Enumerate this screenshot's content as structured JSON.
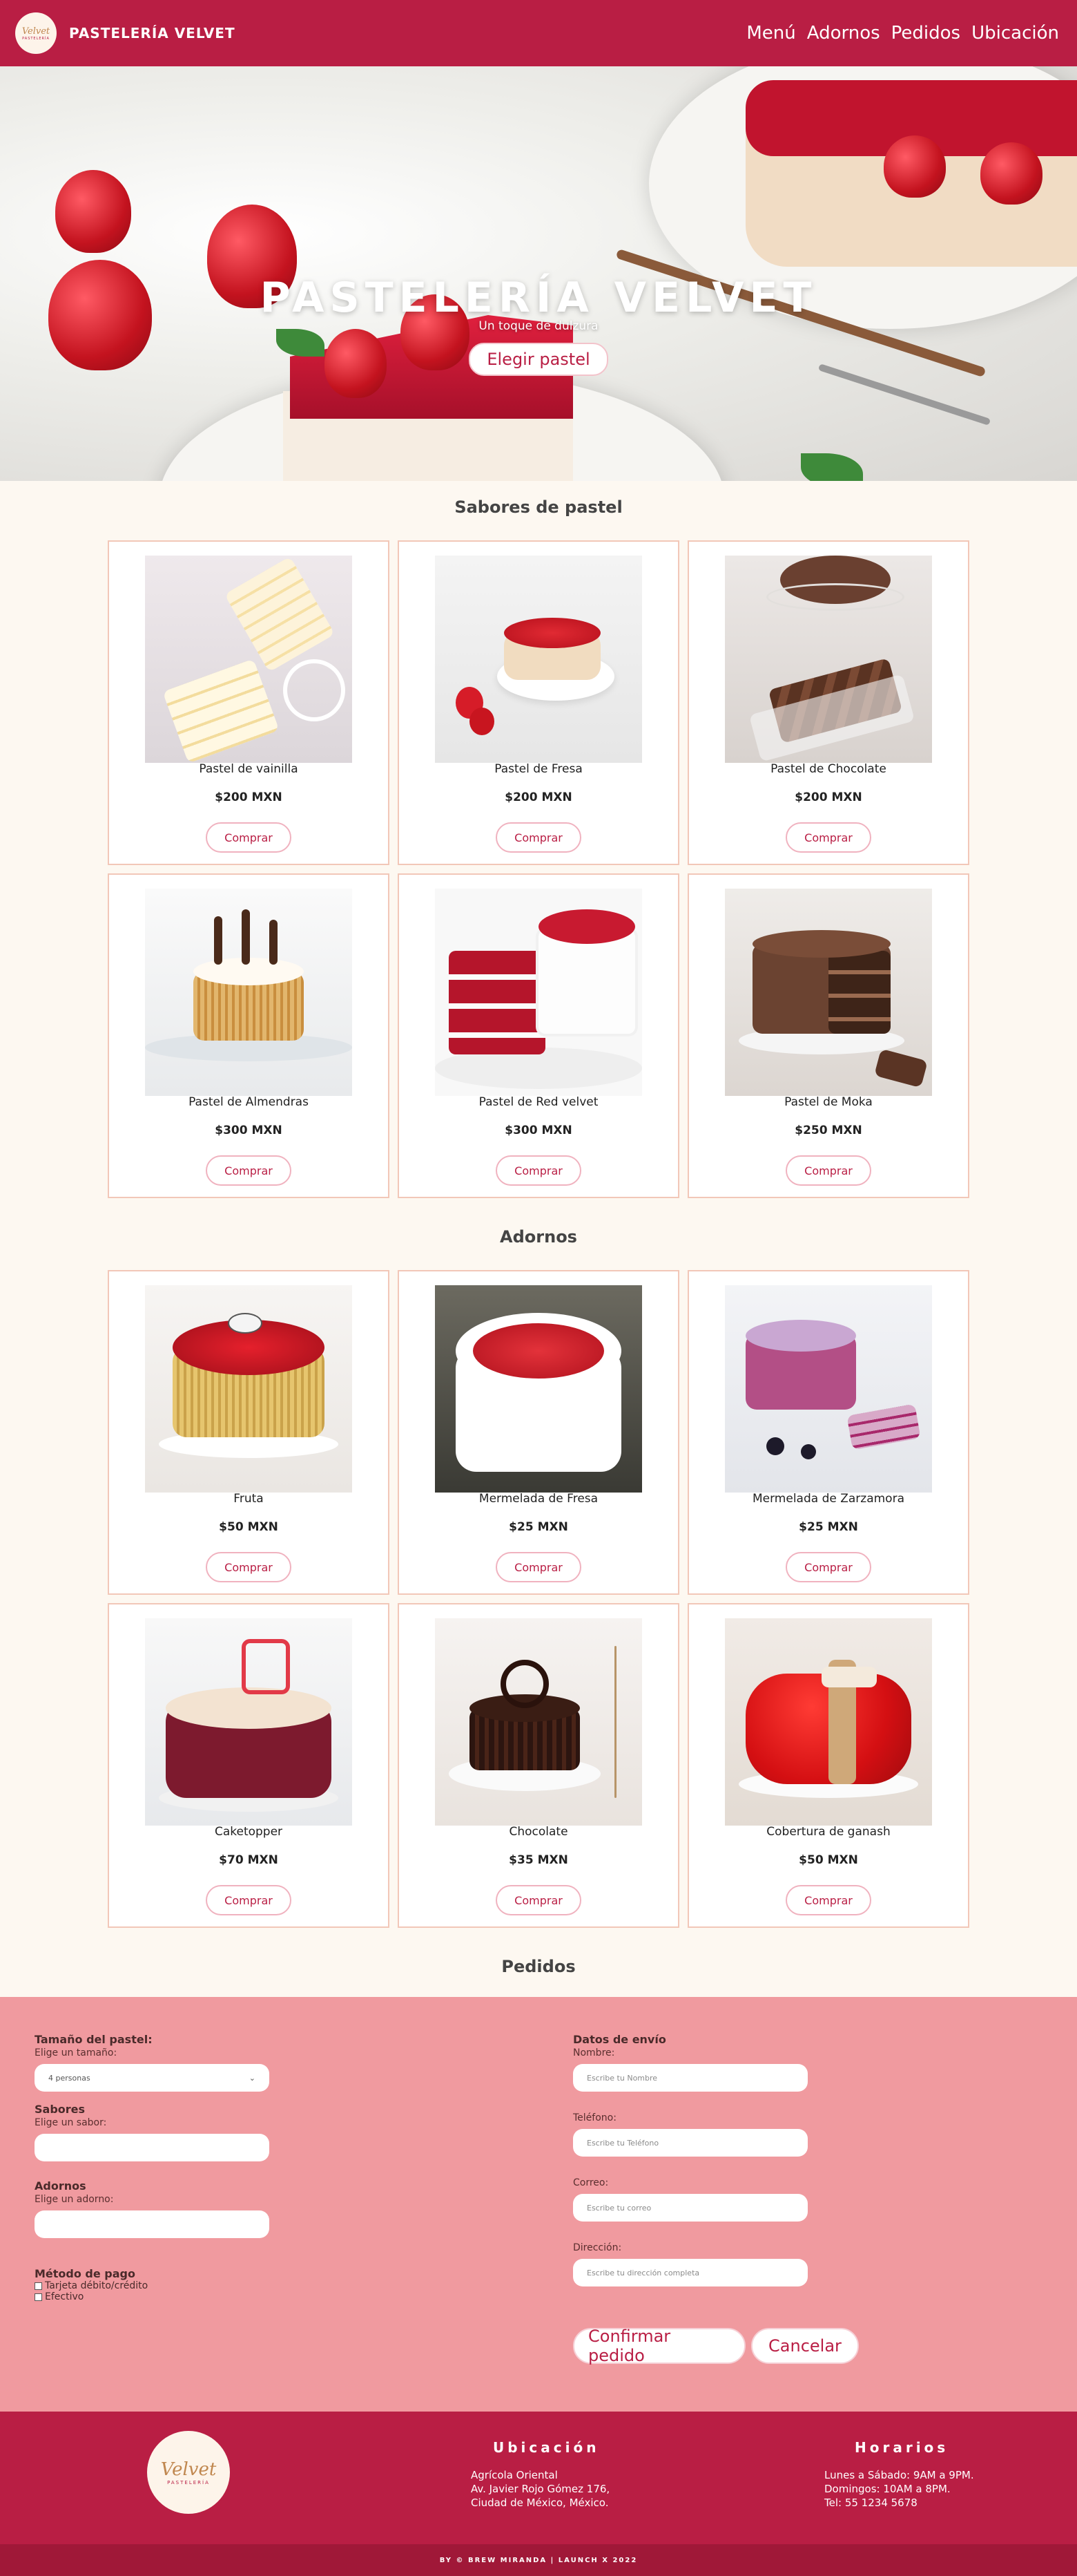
{
  "nav": {
    "logo_text": "Velvet",
    "logo_subtext": "PASTELERÍA",
    "brand": "PASTELERÍA VELVET",
    "links": [
      "Menú",
      "Adornos",
      "Pedidos",
      "Ubicación"
    ]
  },
  "hero": {
    "title": "PASTELERÍA VELVET",
    "subtitle": "Un toque de dulzura",
    "button": "Elegir pastel"
  },
  "flavors": {
    "title": "Sabores de pastel",
    "buy_label": "Comprar",
    "items": [
      {
        "name": "Pastel de vainilla",
        "price": "$200 MXN"
      },
      {
        "name": "Pastel de Fresa",
        "price": "$200 MXN"
      },
      {
        "name": "Pastel de Chocolate",
        "price": "$200 MXN"
      },
      {
        "name": "Pastel de Almendras",
        "price": "$300 MXN"
      },
      {
        "name": "Pastel de Red velvet",
        "price": "$300 MXN"
      },
      {
        "name": "Pastel de Moka",
        "price": "$250 MXN"
      }
    ]
  },
  "toppings": {
    "title": "Adornos",
    "buy_label": "Comprar",
    "items": [
      {
        "name": "Fruta",
        "price": "$50 MXN"
      },
      {
        "name": "Mermelada de Fresa",
        "price": "$25 MXN"
      },
      {
        "name": "Mermelada de Zarzamora",
        "price": "$25 MXN"
      },
      {
        "name": "Caketopper",
        "price": "$70 MXN"
      },
      {
        "name": "Chocolate",
        "price": "$35 MXN"
      },
      {
        "name": "Cobertura de ganash",
        "price": "$50 MXN"
      }
    ]
  },
  "orders": {
    "title": "Pedidos",
    "size_label": "Tamaño del pastel:",
    "size_sub": "Elige un tamaño:",
    "size_value": "4 personas",
    "flavor_label": "Sabores",
    "flavor_sub": "Elige un sabor:",
    "topping_label": "Adornos",
    "topping_sub": "Elige un adorno:",
    "payment_label": "Método de pago",
    "payment_options": [
      "Tarjeta débito/crédito",
      "Efectivo"
    ],
    "shipping_label": "Datos de envío",
    "name_label": "Nombre:",
    "name_placeholder": "Escribe tu Nombre",
    "phone_label": "Teléfono:",
    "phone_placeholder": "Escribe tu Teléfono",
    "email_label": "Correo:",
    "email_placeholder": "Escribe tu correo",
    "address_label": "Dirección:",
    "address_placeholder": "Escribe tu dirección completa",
    "confirm_button": "Confirmar pedido",
    "cancel_button": "Cancelar"
  },
  "footer": {
    "logo_text": "Velvet",
    "logo_subtext": "PASTELERÍA",
    "location_title": "Ubicación",
    "location_lines": [
      "Agrícola Oriental",
      "Av. Javier Rojo Gómez 176,",
      "Ciudad de México, México."
    ],
    "hours_title": "Horarios",
    "hours_lines": [
      "Lunes a Sábado: 9AM a 9PM.",
      "Domingos: 10AM a 8PM.",
      "Tel: 55 1234 5678"
    ],
    "copyright": "BY © BREW MIRANDA | LAUNCH X 2022"
  },
  "colors": {
    "primary": "#b91e44",
    "orders_bg": "#f09a9f",
    "page_bg": "#fdf8f1"
  }
}
